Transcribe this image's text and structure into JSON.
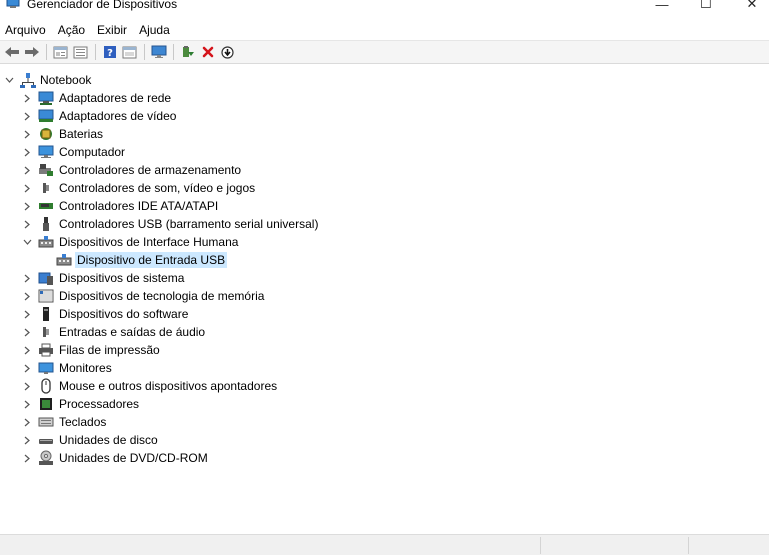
{
  "window": {
    "title": "Gerenciador de Dispositivos",
    "controls": {
      "minimize": "—",
      "maximize": "☐",
      "close": "✕"
    }
  },
  "menu": {
    "items": [
      {
        "label": "Arquivo"
      },
      {
        "label": "Ação"
      },
      {
        "label": "Exibir"
      },
      {
        "label": "Ajuda"
      }
    ]
  },
  "toolbar": {
    "buttons": [
      {
        "icon": "back-arrow-icon"
      },
      {
        "icon": "forward-arrow-icon"
      },
      {
        "icon": "properties-icon"
      },
      {
        "icon": "list-view-icon"
      },
      {
        "icon": "help-icon"
      },
      {
        "icon": "action-icon"
      },
      {
        "icon": "monitor-scan-icon"
      },
      {
        "icon": "update-driver-icon"
      },
      {
        "icon": "uninstall-icon"
      },
      {
        "icon": "download-icon"
      }
    ]
  },
  "tree": {
    "root": {
      "label": "Notebook",
      "icon": "computer-tree-icon",
      "expanded": true
    },
    "categories": [
      {
        "label": "Adaptadores de rede",
        "icon": "network-adapter-icon"
      },
      {
        "label": "Adaptadores de vídeo",
        "icon": "display-adapter-icon"
      },
      {
        "label": "Baterias",
        "icon": "battery-icon"
      },
      {
        "label": "Computador",
        "icon": "computer-icon"
      },
      {
        "label": "Controladores de armazenamento",
        "icon": "storage-controller-icon"
      },
      {
        "label": "Controladores de som, vídeo e jogos",
        "icon": "sound-icon"
      },
      {
        "label": "Controladores IDE ATA/ATAPI",
        "icon": "ide-controller-icon"
      },
      {
        "label": "Controladores USB (barramento serial universal)",
        "icon": "usb-icon"
      },
      {
        "label": "Dispositivos de Interface Humana",
        "icon": "hid-icon",
        "expanded": true,
        "children": [
          {
            "label": "Dispositivo de Entrada USB",
            "icon": "hid-icon",
            "selected": true
          }
        ]
      },
      {
        "label": "Dispositivos de sistema",
        "icon": "system-devices-icon"
      },
      {
        "label": "Dispositivos de tecnologia de memória",
        "icon": "memory-tech-icon"
      },
      {
        "label": "Dispositivos do software",
        "icon": "software-device-icon"
      },
      {
        "label": "Entradas e saídas de áudio",
        "icon": "audio-io-icon"
      },
      {
        "label": "Filas de impressão",
        "icon": "printer-icon"
      },
      {
        "label": "Monitores",
        "icon": "monitor-icon"
      },
      {
        "label": "Mouse e outros dispositivos apontadores",
        "icon": "mouse-icon"
      },
      {
        "label": "Processadores",
        "icon": "processor-icon"
      },
      {
        "label": "Teclados",
        "icon": "keyboard-icon"
      },
      {
        "label": "Unidades de disco",
        "icon": "disk-drive-icon"
      },
      {
        "label": "Unidades de DVD/CD-ROM",
        "icon": "dvd-icon"
      }
    ]
  }
}
